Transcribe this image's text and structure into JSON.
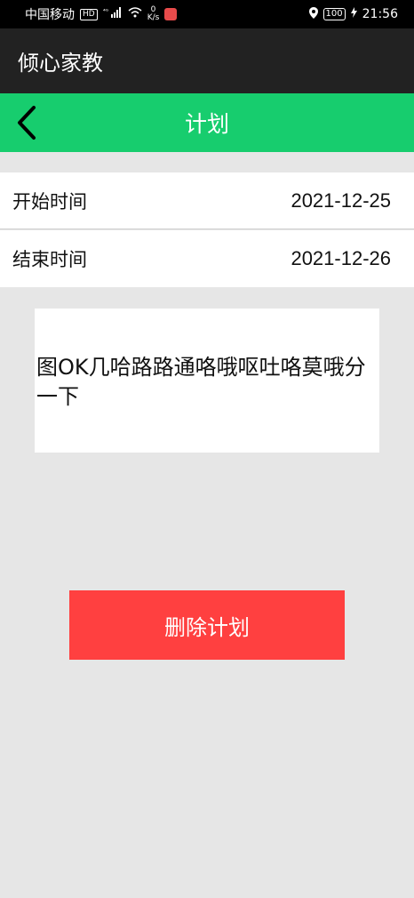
{
  "status_bar": {
    "carrier": "中国移动",
    "hd_badge": "HD",
    "network": "⁴ᴳ",
    "speed_value": "0",
    "speed_unit": "K/s",
    "battery": "100",
    "time": "21:56"
  },
  "app_bar": {
    "title": "倾心家教"
  },
  "nav_bar": {
    "title": "计划"
  },
  "plan": {
    "start_label": "开始时间",
    "start_value": "2021-12-25",
    "end_label": "结束时间",
    "end_value": "2021-12-26",
    "content": "图OK几哈路路通咯哦呕吐咯莫哦分一下"
  },
  "actions": {
    "delete_label": "删除计划"
  },
  "colors": {
    "nav_green": "#17cd6e",
    "delete_red": "#ff4040",
    "app_bar_dark": "#222222",
    "page_bg": "#e6e6e6"
  }
}
